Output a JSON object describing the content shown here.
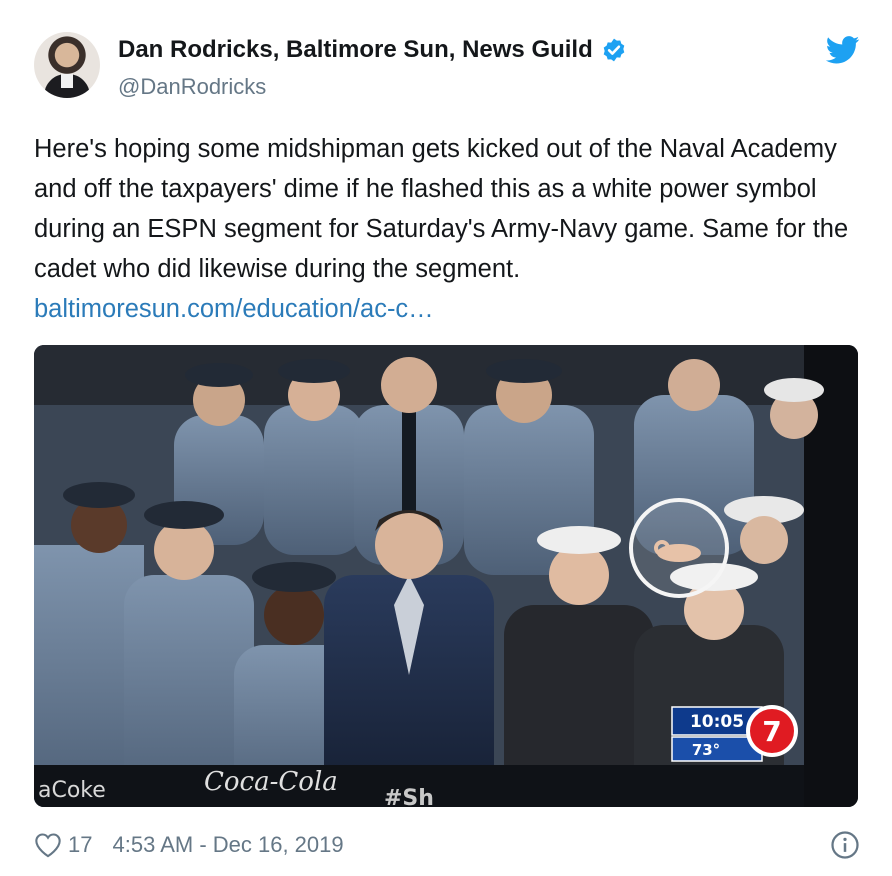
{
  "author": {
    "display_name": "Dan Rodricks, Baltimore Sun, News Guild",
    "handle": "@DanRodricks",
    "avatar_icon": "user-avatar",
    "verified_icon": "verified-badge-icon",
    "platform_icon": "twitter-bird-icon"
  },
  "tweet": {
    "text": "Here's hoping some midshipman gets kicked out of the Naval Academy and off the taxpayers' dime if he flashed this as a white power symbol during an ESPN segment for Saturday's Army-Navy game. Same for the cadet who did likewise during the segment. ",
    "link": "baltimoresun.com/education/ac-c…"
  },
  "media": {
    "broadcast_time": "10:05",
    "broadcast_temp": "73°",
    "station_logo": "7",
    "sponsor_text": "Coca-Cola",
    "banner_left": "aCoke",
    "banner_hashtag": "#Sh"
  },
  "footer": {
    "likes": "17",
    "timestamp": "4:53 AM - Dec 16, 2019",
    "heart_icon": "heart-icon",
    "info_icon": "info-icon"
  },
  "colors": {
    "link": "#2b7bb9",
    "verified": "#1da1f2",
    "muted": "#657786",
    "text": "#14171a"
  }
}
